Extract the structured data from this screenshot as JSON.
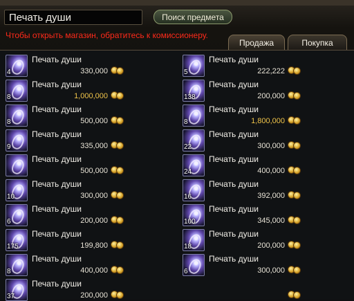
{
  "search": {
    "value": "Печать души"
  },
  "search_button": "Поиск предмета",
  "notice": "Чтобы открыть магазин, обратитесь к комиссионеру.",
  "tabs": [
    {
      "label": "Продажа"
    },
    {
      "label": "Покупка"
    }
  ],
  "items": [
    {
      "name": "Печать души",
      "price": "330,000",
      "count": "4",
      "price_style": "normal"
    },
    {
      "name": "Печать души",
      "price": "222,222",
      "count": "5",
      "price_style": "normal"
    },
    {
      "name": "Печать души",
      "price": "1,000,000",
      "count": "8",
      "price_style": "gold"
    },
    {
      "name": "Печать души",
      "price": "200,000",
      "count": "138",
      "price_style": "normal"
    },
    {
      "name": "Печать души",
      "price": "500,000",
      "count": "8",
      "price_style": "normal"
    },
    {
      "name": "Печать души",
      "price": "1,800,000",
      "count": "8",
      "price_style": "gold"
    },
    {
      "name": "Печать души",
      "price": "335,000",
      "count": "9",
      "price_style": "normal"
    },
    {
      "name": "Печать души",
      "price": "300,000",
      "count": "22",
      "price_style": "normal"
    },
    {
      "name": "Печать души",
      "price": "500,000",
      "count": "",
      "price_style": "normal"
    },
    {
      "name": "Печать души",
      "price": "400,000",
      "count": "24",
      "price_style": "normal"
    },
    {
      "name": "Печать души",
      "price": "300,000",
      "count": "10",
      "price_style": "normal"
    },
    {
      "name": "Печать души",
      "price": "392,000",
      "count": "16",
      "price_style": "normal"
    },
    {
      "name": "Печать души",
      "price": "200,000",
      "count": "6",
      "price_style": "normal"
    },
    {
      "name": "Печать души",
      "price": "345,000",
      "count": "100",
      "price_style": "normal"
    },
    {
      "name": "Печать души",
      "price": "199,800",
      "count": "175",
      "price_style": "normal"
    },
    {
      "name": "Печать души",
      "price": "200,000",
      "count": "18",
      "price_style": "normal"
    },
    {
      "name": "Печать души",
      "price": "400,000",
      "count": "8",
      "price_style": "normal"
    },
    {
      "name": "Печать души",
      "price": "300,000",
      "count": "6",
      "price_style": "normal"
    },
    {
      "name": "Печать души",
      "price": "200,000",
      "count": "37",
      "price_style": "normal"
    },
    {
      "name": "",
      "price": "",
      "count": "",
      "price_style": "normal"
    }
  ]
}
